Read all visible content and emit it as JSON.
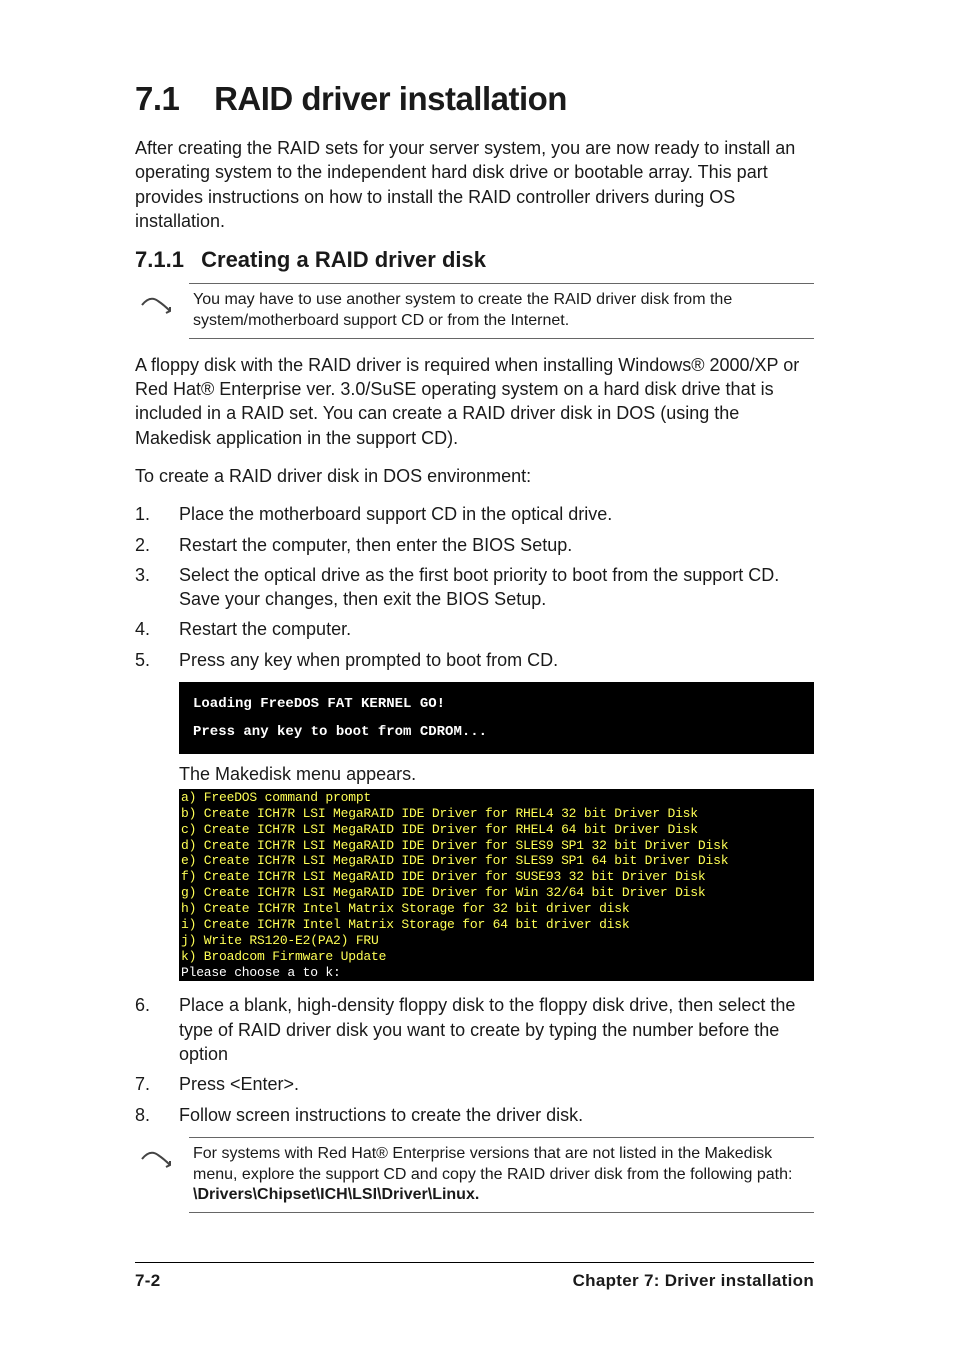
{
  "heading": {
    "number": "7.1",
    "title": "RAID driver installation"
  },
  "intro": "After creating the RAID sets for your server system, you are now ready to install an operating system to the independent hard disk drive or bootable array. This part provides instructions on how to install the RAID controller drivers during OS installation.",
  "subhead": {
    "number": "7.1.1",
    "title": "Creating a RAID driver disk"
  },
  "note1": "You may have to use another system to create the RAID driver disk from the system/motherboard support CD or from the Internet.",
  "para_floppy": "A floppy disk with the RAID driver is required when installing Windows® 2000/XP or Red Hat® Enterprise ver. 3.0/SuSE operating system on a hard disk drive that is included in a RAID set. You can create a RAID driver disk in DOS (using the Makedisk application in the support CD).",
  "para_dos": "To create a RAID driver disk in DOS environment:",
  "steps1": [
    "Place the motherboard support CD in the optical drive.",
    "Restart the computer, then enter the BIOS Setup.",
    "Select the optical drive as the first boot priority to boot from the support CD. Save your changes, then exit the BIOS Setup.",
    "Restart the computer.",
    "Press any key when prompted to boot from CD."
  ],
  "terminal": "Loading FreeDOS FAT KERNEL GO!\nPress any key to boot from CDROM...",
  "menu_caption": "The Makedisk menu appears.",
  "menu_lines": [
    "a) FreeDOS command prompt",
    "b) Create ICH7R LSI MegaRAID IDE Driver for RHEL4 32 bit Driver Disk",
    "c) Create ICH7R LSI MegaRAID IDE Driver for RHEL4 64 bit Driver Disk",
    "d) Create ICH7R LSI MegaRAID IDE Driver for SLES9 SP1 32 bit Driver Disk",
    "e) Create ICH7R LSI MegaRAID IDE Driver for SLES9 SP1 64 bit Driver Disk",
    "f) Create ICH7R LSI MegaRAID IDE Driver for SUSE93 32 bit Driver Disk",
    "g) Create ICH7R LSI MegaRAID IDE Driver for Win 32/64 bit Driver Disk",
    "h) Create ICH7R Intel Matrix Storage for 32 bit driver disk",
    "i) Create ICH7R Intel Matrix Storage for 64 bit driver disk",
    "j) Write RS120-E2(PA2) FRU",
    "k) Broadcom Firmware Update",
    "Please choose a to k:"
  ],
  "steps2": [
    {
      "n": "6.",
      "t": "Place a blank, high-density floppy disk to the floppy disk drive, then select the type of RAID driver disk you want to create by typing the number before the option"
    },
    {
      "n": "7.",
      "t": "Press <Enter>."
    },
    {
      "n": "8.",
      "t": "Follow screen instructions to create the driver disk."
    }
  ],
  "note2": {
    "text": "For systems with Red Hat® Enterprise versions that are not listed in the Makedisk menu, explore the support CD and copy the RAID driver disk from the following path: ",
    "path": "\\Drivers\\Chipset\\ICH\\LSI\\Driver\\Linux."
  },
  "footer": {
    "left": "7-2",
    "right": "Chapter 7: Driver installation"
  }
}
